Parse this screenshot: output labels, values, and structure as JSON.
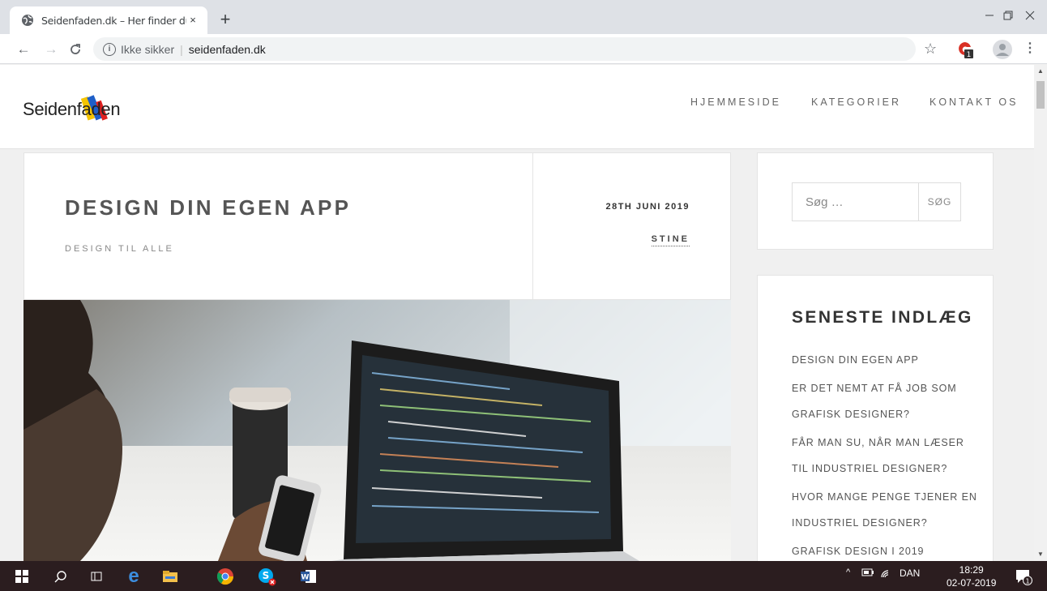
{
  "browser": {
    "tab_title": "Seidenfaden.dk – Her finder du a",
    "tab_close": "×",
    "new_tab": "+",
    "not_secure": "Ikke sikker",
    "url": "seidenfaden.dk",
    "extension_badge": "1"
  },
  "site": {
    "logo": "Seidenfaden",
    "nav": [
      "HJEMMESIDE",
      "KATEGORIER",
      "KONTAKT OS"
    ]
  },
  "article": {
    "title": "DESIGN DIN EGEN APP",
    "category": "DESIGN TIL ALLE",
    "date": "28TH JUNI 2019",
    "author": "STINE"
  },
  "sidebar": {
    "search_placeholder": "Søg …",
    "search_button": "SØG",
    "recent_title": "SENESTE INDLÆG",
    "recent_posts": [
      "DESIGN DIN EGEN APP",
      "ER DET NEMT AT FÅ JOB SOM GRAFISK DESIGNER?",
      "FÅR MAN SU, NÅR MAN LÆSER TIL INDUSTRIEL DESIGNER?",
      "HVOR MANGE PENGE TJENER EN INDUSTRIEL DESIGNER?",
      "GRAFISK DESIGN I 2019"
    ]
  },
  "taskbar": {
    "language": "DAN",
    "time": "18:29",
    "date": "02-07-2019",
    "notification_count": "1"
  }
}
